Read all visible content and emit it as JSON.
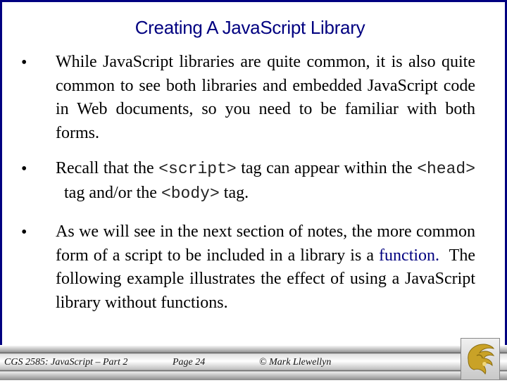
{
  "slide": {
    "title": "Creating A JavaScript Library",
    "bullet_glyph": "•",
    "bullets": [
      {
        "text": "While JavaScript libraries are quite common, it is also quite common to see both libraries and embedded JavaScript code in Web documents, so you need to be familiar with both forms."
      },
      {
        "parts": [
          "Recall that the ",
          "<script>",
          " tag can appear within the ",
          "<head>",
          "  tag and/or the ",
          "<body>",
          " tag."
        ]
      },
      {
        "parts": [
          "As we will see in the next section of notes, the more common form of a script to be included in a library is a ",
          "function.",
          "  The following example illustrates the effect of using a JavaScript library without functions."
        ]
      }
    ]
  },
  "footer": {
    "course": "CGS 2585: JavaScript – Part 2",
    "page": "Page 24",
    "author": "© Mark Llewellyn",
    "logo": "pegasus-logo-icon"
  },
  "colors": {
    "accent": "#000080",
    "logo_gold": "#c9a227"
  }
}
